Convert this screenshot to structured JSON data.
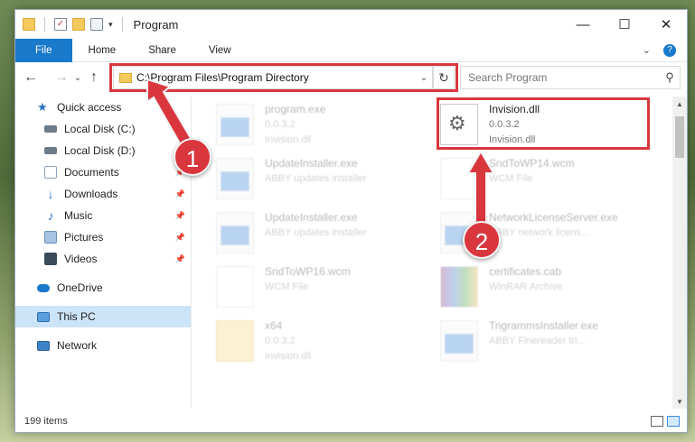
{
  "window": {
    "title": "Program",
    "controls": {
      "minimize": "—",
      "maximize": "☐",
      "close": "✕"
    }
  },
  "quick_access_toolbar": {
    "dropdown": "▾"
  },
  "ribbon": {
    "tabs": [
      "File",
      "Home",
      "Share",
      "View"
    ],
    "expand": "⌄",
    "help": "?"
  },
  "nav": {
    "back": "←",
    "forward": "→",
    "recent": "⌄",
    "up": "↑"
  },
  "address": {
    "path": "C:\\Program Files\\Program Directory",
    "dropdown": "⌄",
    "refresh": "↻"
  },
  "search": {
    "placeholder": "Search Program",
    "icon": "search-icon"
  },
  "sidebar": {
    "items": [
      {
        "label": "Quick access",
        "icon": "star-icon",
        "color": "#2b6fc6",
        "pinned": false
      },
      {
        "label": "Local Disk (C:)",
        "icon": "drive-icon",
        "color": "#6d7b88",
        "pinned": false
      },
      {
        "label": "Local Disk (D:)",
        "icon": "drive-icon",
        "color": "#6d7b88",
        "pinned": false
      },
      {
        "label": "Documents",
        "icon": "documents-icon",
        "color": "#8ba3bf",
        "pinned": true
      },
      {
        "label": "Downloads",
        "icon": "download-icon",
        "color": "#2b6fc6",
        "pinned": true
      },
      {
        "label": "Music",
        "icon": "music-icon",
        "color": "#2b6fc6",
        "pinned": true
      },
      {
        "label": "Pictures",
        "icon": "pictures-icon",
        "color": "#6b8fb8",
        "pinned": true
      },
      {
        "label": "Videos",
        "icon": "videos-icon",
        "color": "#3a4b5c",
        "pinned": true
      },
      {
        "label": "OneDrive",
        "icon": "cloud-icon",
        "color": "#1979ca",
        "pinned": false
      },
      {
        "label": "This PC",
        "icon": "computer-icon",
        "color": "#5aa0e0",
        "pinned": false
      },
      {
        "label": "Network",
        "icon": "network-icon",
        "color": "#3b82c9",
        "pinned": false
      }
    ],
    "pin_glyph": "📌"
  },
  "files": [
    {
      "name": "program.exe",
      "sub1": "0.0.3.2",
      "sub2": "Invision.dll",
      "icon": "exe-icon"
    },
    {
      "name": "Invision.dll",
      "sub1": "0.0.3.2",
      "sub2": "Invision.dll",
      "icon": "dll-icon"
    },
    {
      "name": "UpdateInstaller.exe",
      "sub1": "ABBY updates installer",
      "sub2": "",
      "icon": "exe-icon"
    },
    {
      "name": "SndToWP14.wcm",
      "sub1": "WCM File",
      "sub2": "",
      "icon": "file-icon"
    },
    {
      "name": "UpdateInstaller.exe",
      "sub1": "ABBY updates installer",
      "sub2": "",
      "icon": "exe-icon"
    },
    {
      "name": "NetworkLicenseServer.exe",
      "sub1": "ABBY network licens...",
      "sub2": "",
      "icon": "exe-icon"
    },
    {
      "name": "SndToWP16.wcm",
      "sub1": "WCM File",
      "sub2": "",
      "icon": "file-icon"
    },
    {
      "name": "certificates.cab",
      "sub1": "WinRAR Archive",
      "sub2": "",
      "icon": "archive-icon"
    },
    {
      "name": "x64",
      "sub1": "0.0.3.2",
      "sub2": "Invision.dll",
      "icon": "folder-icon"
    },
    {
      "name": "TrigrammsInstaller.exe",
      "sub1": "ABBY Finereader tri...",
      "sub2": "",
      "icon": "exe-icon"
    }
  ],
  "status": {
    "count": "199 items"
  },
  "annotations": {
    "badge1": "1",
    "badge2": "2",
    "accent": "#d9363e"
  }
}
